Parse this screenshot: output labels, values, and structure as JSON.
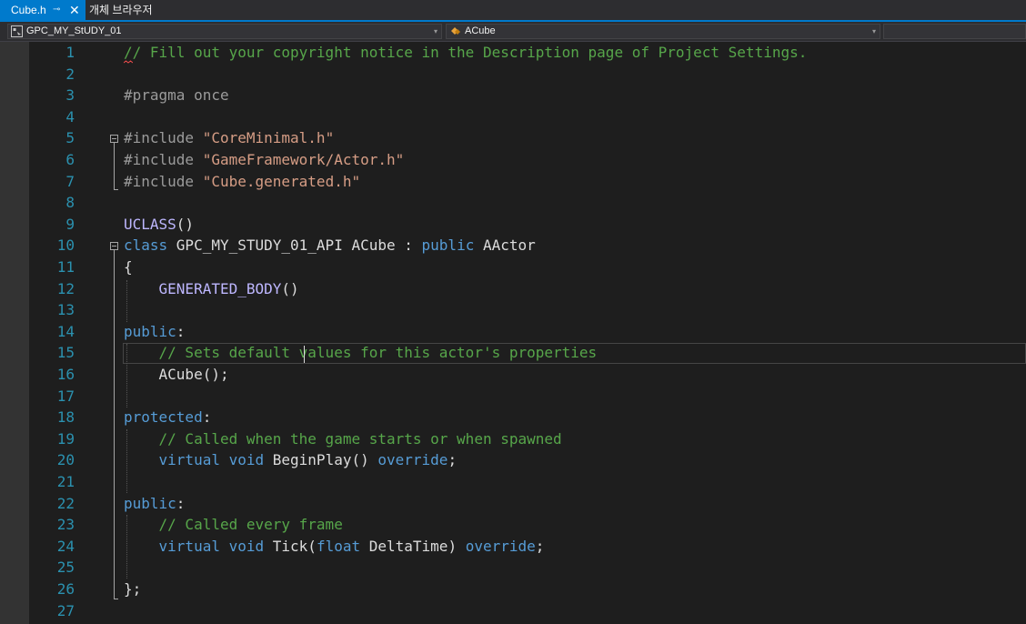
{
  "tabs": {
    "active": {
      "label": "Cube.h",
      "pin": "⊸",
      "close": "✕"
    },
    "inactive": {
      "label": "개체 브라우저"
    }
  },
  "nav": {
    "project": "GPC_MY_StUDY_01",
    "member": "ACube",
    "dropdown_arrow": "▾"
  },
  "editor": {
    "lines": [
      {
        "n": "1",
        "tokens": [
          {
            "t": "// Fill out your copyright notice in the Description page of Project Settings.",
            "c": "comment"
          }
        ]
      },
      {
        "n": "2",
        "tokens": []
      },
      {
        "n": "3",
        "tokens": [
          {
            "t": "#pragma once",
            "c": "pp"
          }
        ]
      },
      {
        "n": "4",
        "tokens": []
      },
      {
        "n": "5",
        "tokens": [
          {
            "t": "#include ",
            "c": "pp"
          },
          {
            "t": "\"CoreMinimal.h\"",
            "c": "str"
          }
        ]
      },
      {
        "n": "6",
        "tokens": [
          {
            "t": "#include ",
            "c": "pp"
          },
          {
            "t": "\"GameFramework/Actor.h\"",
            "c": "str"
          }
        ]
      },
      {
        "n": "7",
        "tokens": [
          {
            "t": "#include ",
            "c": "pp"
          },
          {
            "t": "\"Cube.generated.h\"",
            "c": "str"
          }
        ]
      },
      {
        "n": "8",
        "tokens": []
      },
      {
        "n": "9",
        "tokens": [
          {
            "t": "UCLASS",
            "c": "macro"
          },
          {
            "t": "()",
            "c": "plain"
          }
        ]
      },
      {
        "n": "10",
        "tokens": [
          {
            "t": "class ",
            "c": "kw"
          },
          {
            "t": "GPC_MY_STUDY_01_API ",
            "c": "plain"
          },
          {
            "t": "ACube",
            "c": "plain"
          },
          {
            "t": " : ",
            "c": "plain"
          },
          {
            "t": "public ",
            "c": "kw"
          },
          {
            "t": "AActor",
            "c": "plain"
          }
        ]
      },
      {
        "n": "11",
        "tokens": [
          {
            "t": "{",
            "c": "plain"
          }
        ]
      },
      {
        "n": "12",
        "tokens": [
          {
            "t": "    GENERATED_BODY",
            "c": "macro"
          },
          {
            "t": "()",
            "c": "plain"
          }
        ]
      },
      {
        "n": "13",
        "tokens": []
      },
      {
        "n": "14",
        "tokens": [
          {
            "t": "public",
            "c": "kw"
          },
          {
            "t": ":",
            "c": "plain"
          }
        ]
      },
      {
        "n": "15",
        "tokens": [
          {
            "t": "    // Sets default values for this actor's properties",
            "c": "comment"
          }
        ]
      },
      {
        "n": "16",
        "tokens": [
          {
            "t": "    ACube",
            "c": "plain"
          },
          {
            "t": "();",
            "c": "plain"
          }
        ]
      },
      {
        "n": "17",
        "tokens": []
      },
      {
        "n": "18",
        "tokens": [
          {
            "t": "protected",
            "c": "kw"
          },
          {
            "t": ":",
            "c": "plain"
          }
        ]
      },
      {
        "n": "19",
        "tokens": [
          {
            "t": "    // Called when the game starts or when spawned",
            "c": "comment"
          }
        ]
      },
      {
        "n": "20",
        "tokens": [
          {
            "t": "    virtual ",
            "c": "kw"
          },
          {
            "t": "void ",
            "c": "kw"
          },
          {
            "t": "BeginPlay",
            "c": "plain"
          },
          {
            "t": "() ",
            "c": "plain"
          },
          {
            "t": "override",
            "c": "kw"
          },
          {
            "t": ";",
            "c": "plain"
          }
        ]
      },
      {
        "n": "21",
        "tokens": []
      },
      {
        "n": "22",
        "tokens": [
          {
            "t": "public",
            "c": "kw"
          },
          {
            "t": ":",
            "c": "plain"
          }
        ]
      },
      {
        "n": "23",
        "tokens": [
          {
            "t": "    // Called every frame",
            "c": "comment"
          }
        ]
      },
      {
        "n": "24",
        "tokens": [
          {
            "t": "    virtual ",
            "c": "kw"
          },
          {
            "t": "void ",
            "c": "kw"
          },
          {
            "t": "Tick",
            "c": "plain"
          },
          {
            "t": "(",
            "c": "plain"
          },
          {
            "t": "float ",
            "c": "kw"
          },
          {
            "t": "DeltaTime",
            "c": "plain"
          },
          {
            "t": ") ",
            "c": "plain"
          },
          {
            "t": "override",
            "c": "kw"
          },
          {
            "t": ";",
            "c": "plain"
          }
        ]
      },
      {
        "n": "25",
        "tokens": []
      },
      {
        "n": "26",
        "tokens": [
          {
            "t": "};",
            "c": "plain"
          }
        ]
      },
      {
        "n": "27",
        "tokens": []
      }
    ]
  },
  "colors": {
    "accent": "#007acc",
    "background": "#1e1e1e",
    "line_number": "#2b91af",
    "comment": "#57a64a",
    "keyword": "#569cd6",
    "string": "#d69d85"
  }
}
